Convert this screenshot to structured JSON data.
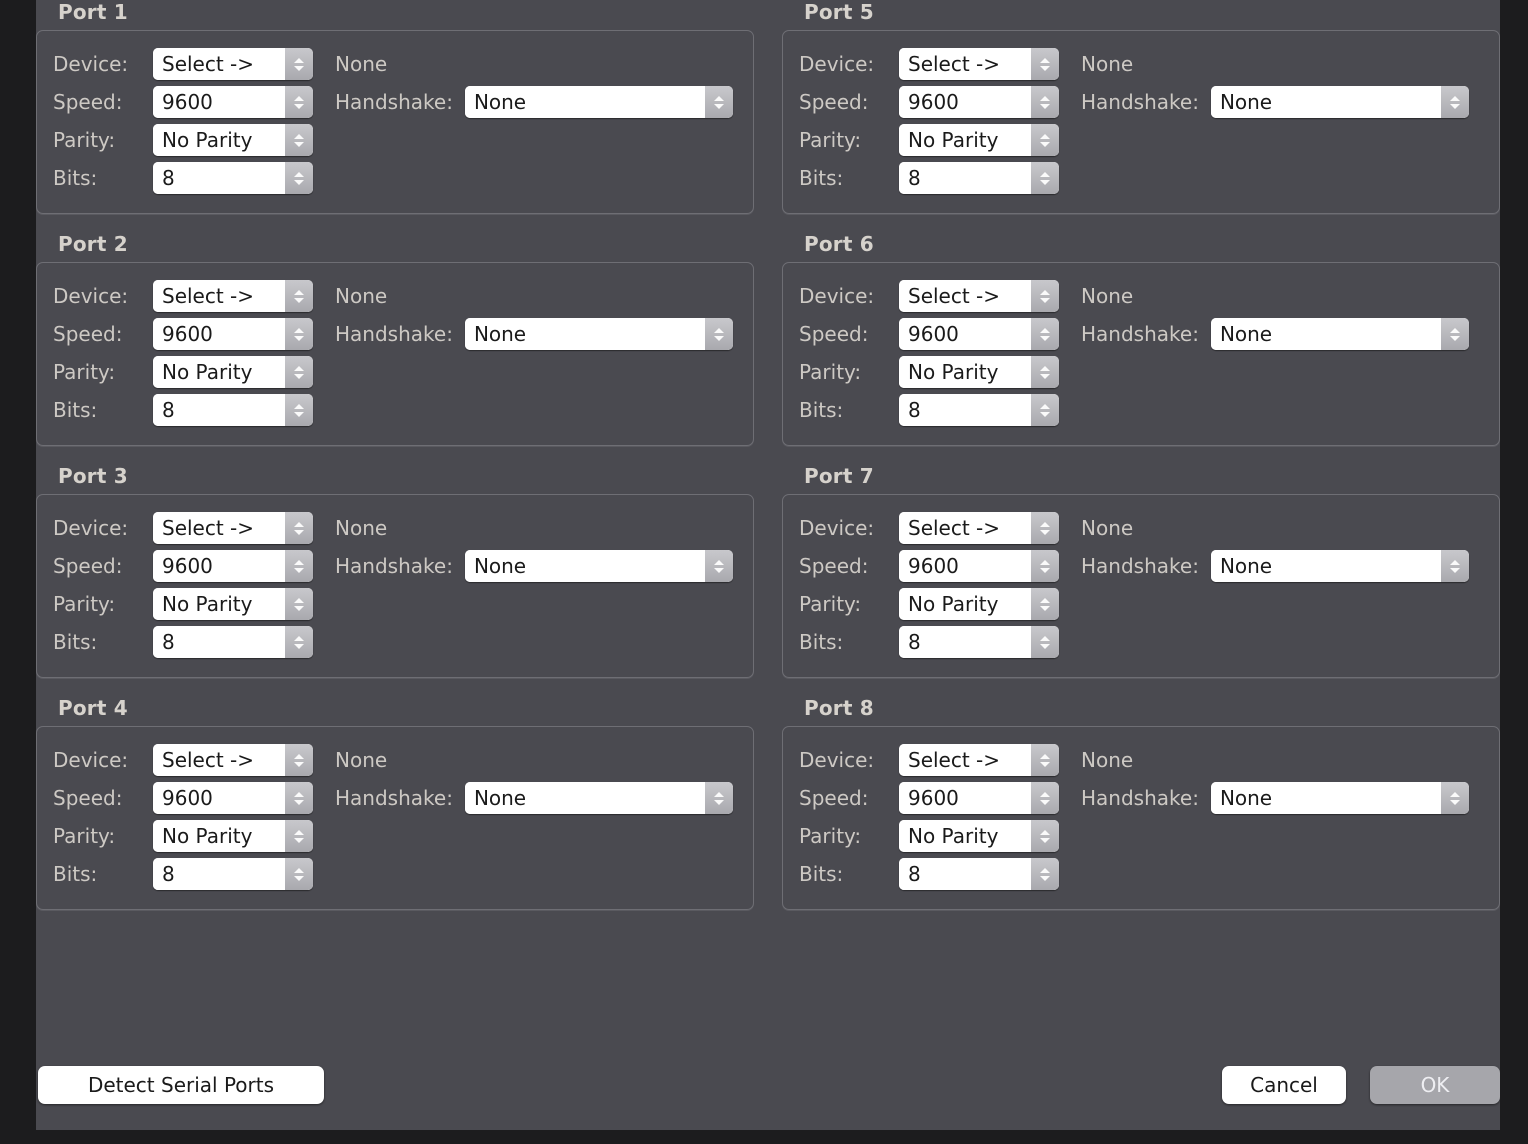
{
  "dialog": {
    "background_color": "#4a4a50",
    "frame_color": "#1c1c1e"
  },
  "labels": {
    "device": "Device:",
    "speed": "Speed:",
    "parity": "Parity:",
    "bits": "Bits:",
    "handshake": "Handshake:"
  },
  "ports": [
    {
      "title": "Port 1",
      "device": "Select ->",
      "device_status": "None",
      "speed": "9600",
      "handshake": "None",
      "parity": "No Parity",
      "bits": "8"
    },
    {
      "title": "Port 2",
      "device": "Select ->",
      "device_status": "None",
      "speed": "9600",
      "handshake": "None",
      "parity": "No Parity",
      "bits": "8"
    },
    {
      "title": "Port 3",
      "device": "Select ->",
      "device_status": "None",
      "speed": "9600",
      "handshake": "None",
      "parity": "No Parity",
      "bits": "8"
    },
    {
      "title": "Port 4",
      "device": "Select ->",
      "device_status": "None",
      "speed": "9600",
      "handshake": "None",
      "parity": "No Parity",
      "bits": "8"
    },
    {
      "title": "Port 5",
      "device": "Select ->",
      "device_status": "None",
      "speed": "9600",
      "handshake": "None",
      "parity": "No Parity",
      "bits": "8"
    },
    {
      "title": "Port 6",
      "device": "Select ->",
      "device_status": "None",
      "speed": "9600",
      "handshake": "None",
      "parity": "No Parity",
      "bits": "8"
    },
    {
      "title": "Port 7",
      "device": "Select ->",
      "device_status": "None",
      "speed": "9600",
      "handshake": "None",
      "parity": "No Parity",
      "bits": "8"
    },
    {
      "title": "Port 8",
      "device": "Select ->",
      "device_status": "None",
      "speed": "9600",
      "handshake": "None",
      "parity": "No Parity",
      "bits": "8"
    }
  ],
  "footer": {
    "detect_label": "Detect Serial Ports",
    "cancel_label": "Cancel",
    "ok_label": "OK",
    "ok_enabled": false
  }
}
